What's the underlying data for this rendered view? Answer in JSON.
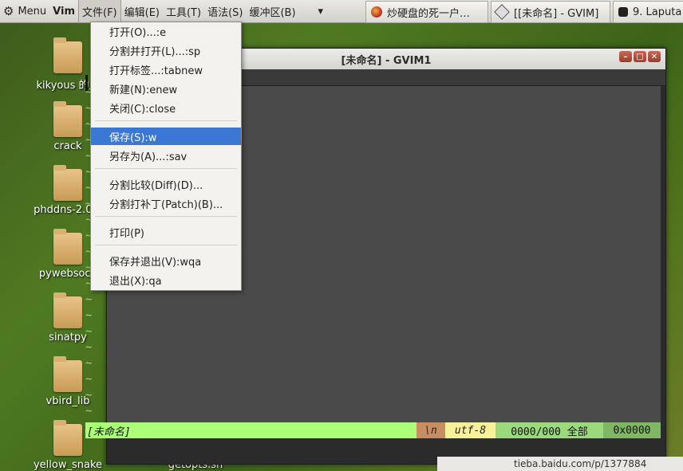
{
  "topbar": {
    "menu_label": "Menu",
    "app_label": "Vim",
    "menus": [
      "文件(F)",
      "编辑(E)",
      "工具(T)",
      "语法(S)",
      "缓冲区(B)"
    ],
    "overflow": "▾",
    "tasks": [
      "炒硬盘的死一户…",
      "[[未命名] - GVIM]",
      "9. Laputa"
    ]
  },
  "desktop": {
    "icons": [
      "kikyous 的主",
      "crack",
      "phddns-2.0.1",
      "pywebsock",
      "sinatpy",
      "vbird_lib",
      "yellow_snake",
      "getopts.sh"
    ]
  },
  "gvim": {
    "title": "[未命名] - GVIM1",
    "status": {
      "filename": "[未命名]",
      "fileformat": "\\n",
      "encoding": "utf-8",
      "position": "0000/000 全部",
      "hex": "0x0000"
    }
  },
  "file_menu": {
    "items": [
      "打开(O)...:e",
      "分割并打开(L)...:sp",
      "打开标签...:tabnew",
      "新建(N):enew",
      "关闭(C):close",
      "保存(S):w",
      "另存为(A)...:sav",
      "分割比较(Diff)(D)...",
      "分割打补丁(Patch)(B)...",
      "打印(P)",
      "保存并退出(V):wqa",
      "退出(X):qa"
    ],
    "selected": "保存(S):w"
  },
  "bottom_strip": {
    "text": "tieba.baidu.com/p/1377884"
  },
  "colors": {
    "selection": "#3b78d4",
    "status_green": "#aaff77",
    "editor_bg": "#4a4a4a"
  }
}
